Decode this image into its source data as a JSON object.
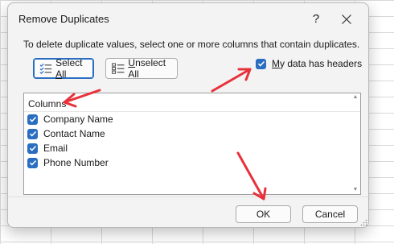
{
  "dialog": {
    "title": "Remove Duplicates",
    "help": "?",
    "instructions": "To delete duplicate values, select one or more columns that contain duplicates.",
    "select_all": {
      "pre": "Select ",
      "ul": "A",
      "post": "ll"
    },
    "unselect_all": {
      "pre": "",
      "ul": "U",
      "post": "nselect All"
    },
    "headers": {
      "ul": "M",
      "post": "y data has headers",
      "checked": true
    },
    "columns_header": "Columns",
    "columns": [
      {
        "label": "Company Name",
        "checked": true
      },
      {
        "label": "Contact Name",
        "checked": true
      },
      {
        "label": "Email",
        "checked": true
      },
      {
        "label": "Phone Number",
        "checked": true
      }
    ],
    "ok_label": "OK",
    "cancel_label": "Cancel"
  },
  "colors": {
    "accent": "#2a6ec1",
    "annotation_arrow": "#e8313a"
  }
}
